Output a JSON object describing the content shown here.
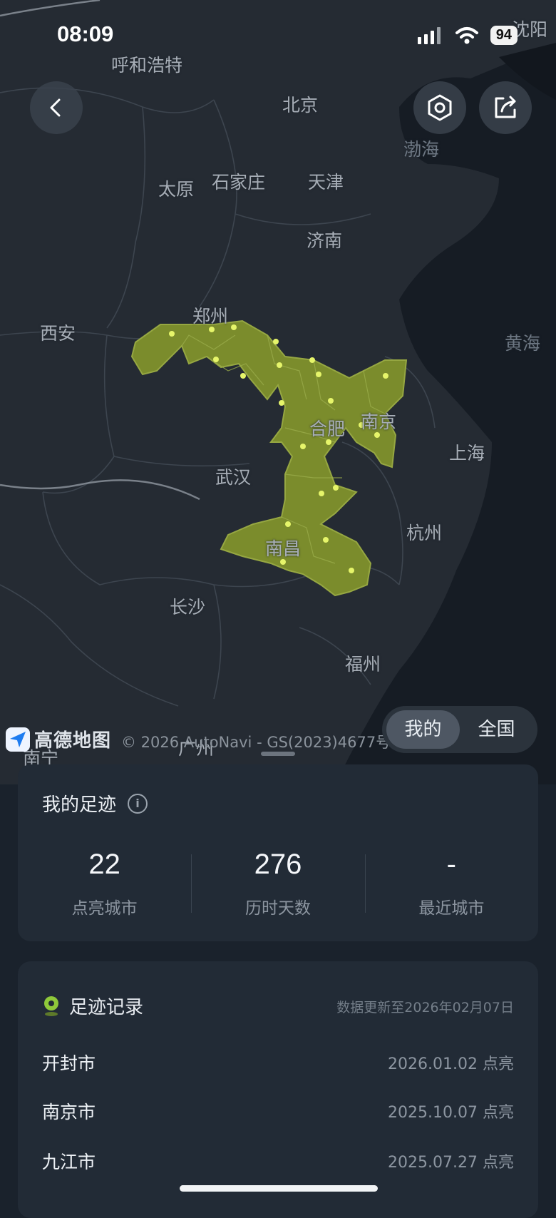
{
  "status_bar": {
    "time": "08:09",
    "battery": "94"
  },
  "map": {
    "city_labels": [
      "呼和浩特",
      "北京",
      "沈阳",
      "太原",
      "石家庄",
      "天津",
      "渤海",
      "济南",
      "郑州",
      "西安",
      "黄海",
      "合肥",
      "南京",
      "武汉",
      "上海",
      "杭州",
      "南昌",
      "长沙",
      "福州",
      "南宁",
      "广州"
    ],
    "logo_text": "高德地图",
    "copyright": "© 2026 AutoNavi - GS(2023)4677号",
    "highlight_color": "#7b8c2c",
    "dot_color": "#e6f56a"
  },
  "toggle": {
    "mine": "我的",
    "national": "全国",
    "active": "mine"
  },
  "footprint": {
    "title": "我的足迹",
    "stats": [
      {
        "value": "22",
        "label": "点亮城市"
      },
      {
        "value": "276",
        "label": "历时天数"
      },
      {
        "value": "-",
        "label": "最近城市"
      }
    ]
  },
  "records": {
    "title": "足迹记录",
    "updated": "数据更新至2026年02月07日",
    "items": [
      {
        "city": "开封市",
        "date": "2026.01.02 点亮"
      },
      {
        "city": "南京市",
        "date": "2025.10.07 点亮"
      },
      {
        "city": "九江市",
        "date": "2025.07.27 点亮"
      }
    ]
  }
}
